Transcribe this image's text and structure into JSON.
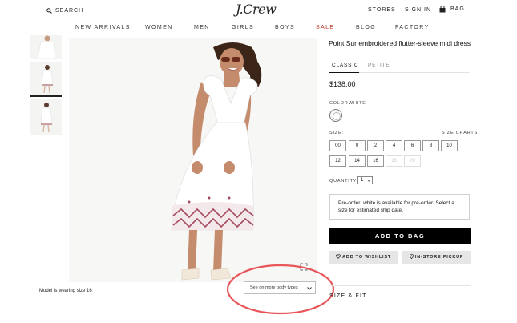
{
  "header": {
    "search_label": "SEARCH",
    "logo": "J.Crew",
    "stores_label": "STORES",
    "sign_in_label": "SIGN IN",
    "bag_label": "BAG"
  },
  "nav": {
    "items": [
      "NEW ARRIVALS",
      "WOMEN",
      "MEN",
      "GIRLS",
      "BOYS",
      "SALE",
      "BLOG",
      "FACTORY"
    ],
    "sale_color": "#c0392b"
  },
  "gallery": {
    "model_caption": "Model is wearing size 16",
    "body_types_dropdown": "See on more body types"
  },
  "product": {
    "title": "Point Sur embroidered flutter-sleeve midi dress",
    "tabs": [
      "CLASSIC",
      "PETITE"
    ],
    "active_tab": "CLASSIC",
    "price": "$138.00",
    "color_label": "COLOR:",
    "color_value": "WHITE",
    "size_label": "SIZE:",
    "size_charts_label": "SIZE CHARTS",
    "sizes": [
      "00",
      "0",
      "2",
      "4",
      "6",
      "8",
      "10",
      "12",
      "14",
      "16",
      "18",
      "20"
    ],
    "disabled_sizes": [
      "18",
      "20"
    ],
    "quantity_label": "QUANTITY:",
    "quantity_value": "1",
    "preorder_text": "Pre-order: white is available for pre-order. Select a size for estimated ship date.",
    "add_to_bag": "ADD TO BAG",
    "add_to_wishlist": "ADD TO WISHLIST",
    "in_store_pickup": "IN-STORE PICKUP",
    "size_fit": "SIZE & FIT"
  },
  "annotation": {
    "circle_color": "#e8565a"
  }
}
